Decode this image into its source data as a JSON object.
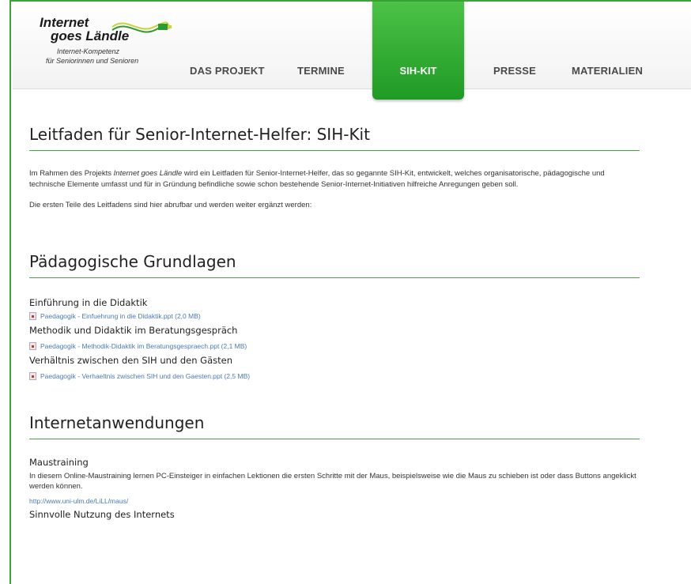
{
  "logo": {
    "line1": "Internet",
    "line2": "goes Ländle",
    "tagline1": "Internet-Kompetenz",
    "tagline2": "für Seniorinnen und Senioren"
  },
  "nav": {
    "items": [
      "DAS PROJEKT",
      "TERMINE",
      "SIH-KIT",
      "PRESSE",
      "MATERIALIEN"
    ],
    "active": "SIH-KIT"
  },
  "page": {
    "title": "Leitfaden für Senior-Internet-Helfer: SIH-Kit",
    "intro_before": "Im Rahmen des Projekts ",
    "intro_italic": "Internet goes Ländle",
    "intro_after": " wird ein Leitfaden für Senior-Internet-Helfer, das so gegannte SIH-Kit, entwickelt, welches organisatorische, pädagogische und technische Elemente umfasst und für in Gründung befindliche sowie schon bestehende Senior-Internet-Initiativen hilfreiche Anregungen geben soll.",
    "intro2": "Die ersten Teile des Leitfadens sind hier abrufbar und werden weiter ergänzt werden:"
  },
  "section1": {
    "title": "Pädagogische Grundlagen",
    "items": [
      {
        "heading": "Einführung in die Didaktik",
        "file": "Paedagogik - Einfuehrung in die Didaktik.ppt (2,0 MB)"
      },
      {
        "heading": "Methodik und Didaktik im Beratungsgespräch",
        "file": "Paedagogik - Methodik-Didaktik im Beratungsgespraech.ppt (2,1 MB)"
      },
      {
        "heading": "Verhältnis zwischen den SIH und den Gästen",
        "file": "Paedagogik - Verhaeltnis zwischen SIH und den Gaesten.ppt (2,5 MB)"
      }
    ]
  },
  "section2": {
    "title": "Internetanwendungen",
    "item1": {
      "heading": "Maustraining",
      "text": "In diesem Online-Maustraining lernen PC-Einsteiger in einfachen Lektionen die ersten Schritte mit der Maus, beispielsweise wie die Maus zu schieben ist oder dass Buttons angeklickt werden können.",
      "link": "http://www.uni-ulm.de/LiLL/maus/"
    },
    "item2": {
      "heading": "Sinnvolle Nutzung des Internets"
    }
  },
  "colors": {
    "accent": "#3aa335",
    "nav_active": "#2aa52c",
    "link": "#4a7ab5"
  }
}
